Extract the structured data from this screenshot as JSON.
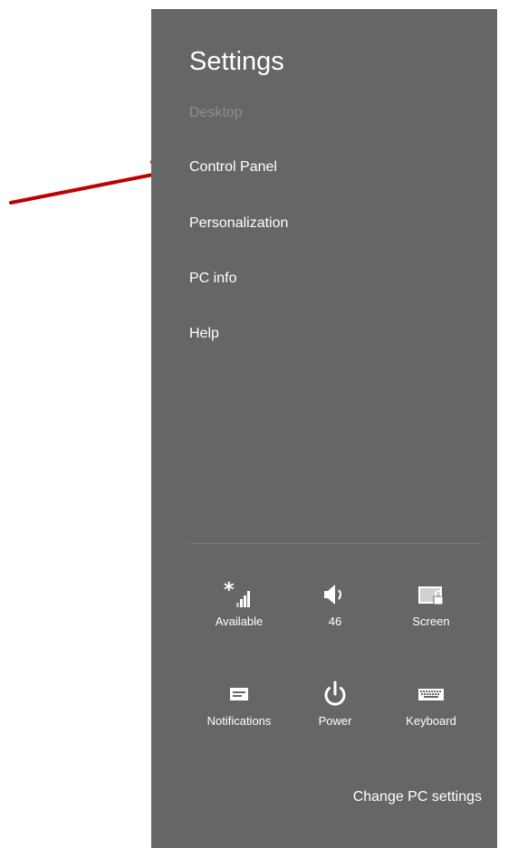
{
  "settings_pane": {
    "title": "Settings",
    "items": [
      {
        "label": "Desktop",
        "enabled": false
      },
      {
        "label": "Control Panel",
        "enabled": true
      },
      {
        "label": "Personalization",
        "enabled": true
      },
      {
        "label": "PC info",
        "enabled": true
      },
      {
        "label": "Help",
        "enabled": true
      }
    ],
    "quick_tiles": [
      {
        "label": "Available",
        "icon": "network-signal-icon"
      },
      {
        "label": "46",
        "icon": "volume-icon"
      },
      {
        "label": "Screen",
        "icon": "screen-icon"
      },
      {
        "label": "Notifications",
        "icon": "notifications-icon"
      },
      {
        "label": "Power",
        "icon": "power-icon"
      },
      {
        "label": "Keyboard",
        "icon": "keyboard-icon"
      }
    ],
    "change_pc_settings": "Change PC settings"
  },
  "colors": {
    "pane_background": "#666666",
    "text": "#ffffff",
    "disabled_text": "#8c8c8c",
    "annotation_arrow": "#c00000"
  }
}
